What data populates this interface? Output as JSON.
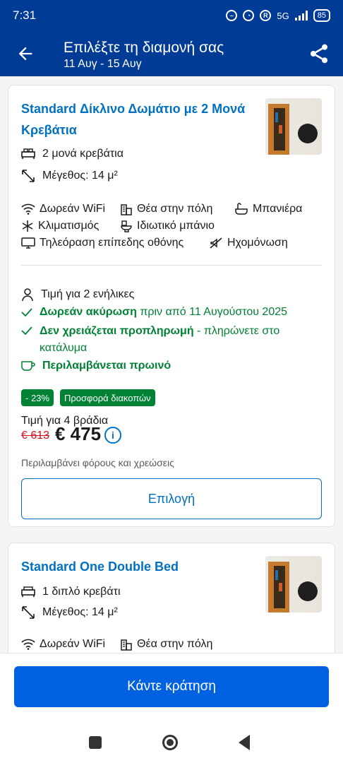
{
  "status": {
    "time": "7:31",
    "network": "5G",
    "battery": "85"
  },
  "header": {
    "title": "Επιλέξτε τη διαμονή σας",
    "dates": "11 Αυγ - 15 Αυγ"
  },
  "rooms": [
    {
      "title": "Standard Δίκλινο Δωμάτιο με 2 Μονά Κρεβάτια",
      "beds": "2 μονά κρεβάτια",
      "size": "Μέγεθος: 14 μ²",
      "amenities": [
        "Δωρεάν WiFi",
        "Θέα στην πόλη",
        "Μπανιέρα",
        "Κλιματισμός",
        "Ιδιωτικό μπάνιο",
        "Τηλεόραση επίπεδης οθόνης",
        "Ηχομόνωση"
      ],
      "price_for": "Τιμή για 2 ενήλικες",
      "free_cancel_bold": "Δωρεάν ακύρωση",
      "free_cancel_rest": " πριν από 11 Αυγούστου 2025",
      "no_prepay_bold": "Δεν χρειάζεται προπληρωμή",
      "no_prepay_rest": " - πληρώνετε στο κατάλυμα",
      "breakfast": "Περιλαμβάνεται πρωινό",
      "discount_badge": "- 23%",
      "deal_badge": "Προσφορά διακοπών",
      "nights_label": "Τιμή για 4 βράδια",
      "old_price": "€ 613",
      "new_price": "€ 475",
      "taxes_note": "Περιλαμβάνει φόρους και χρεώσεις",
      "select_label": "Επιλογή"
    },
    {
      "title": "Standard One Double Bed",
      "beds": "1 διπλό κρεβάτι",
      "size": "Μέγεθος: 14 μ²",
      "amenities": [
        "Δωρεάν WiFi",
        "Θέα στην πόλη"
      ]
    }
  ],
  "footer": {
    "book_label": "Κάντε κράτηση"
  },
  "colors": {
    "brand_blue": "#003b95",
    "link_blue": "#0071c2",
    "green": "#008234",
    "red": "#d4111e",
    "button_blue": "#0062e0"
  }
}
